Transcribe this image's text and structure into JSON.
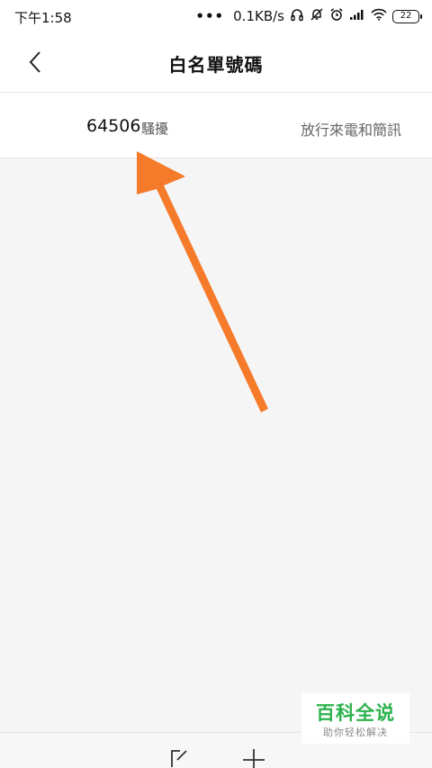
{
  "status_bar": {
    "time": "下午1:58",
    "dots": "•••",
    "network_speed": "0.1KB/s",
    "battery": "22",
    "icons": [
      "headphones-icon",
      "silent-bell-icon",
      "alarm-icon",
      "signal-icon",
      "wifi-icon",
      "battery-icon"
    ]
  },
  "header": {
    "title": "白名單號碼",
    "back_icon": "back-chevron-icon"
  },
  "list": {
    "items": [
      {
        "number": "64506",
        "tag": "騷擾",
        "action": "放行來電和簡訊"
      }
    ]
  },
  "annotation": {
    "arrow_color": "#f57a2a"
  },
  "bottom_bar": {
    "buttons": [
      "edit-icon",
      "add-icon"
    ]
  },
  "watermark": {
    "title": "百科全说",
    "subtitle": "助你轻松解决"
  },
  "colors": {
    "background": "#f5f5f5",
    "watermark_green": "#2bb24c"
  }
}
